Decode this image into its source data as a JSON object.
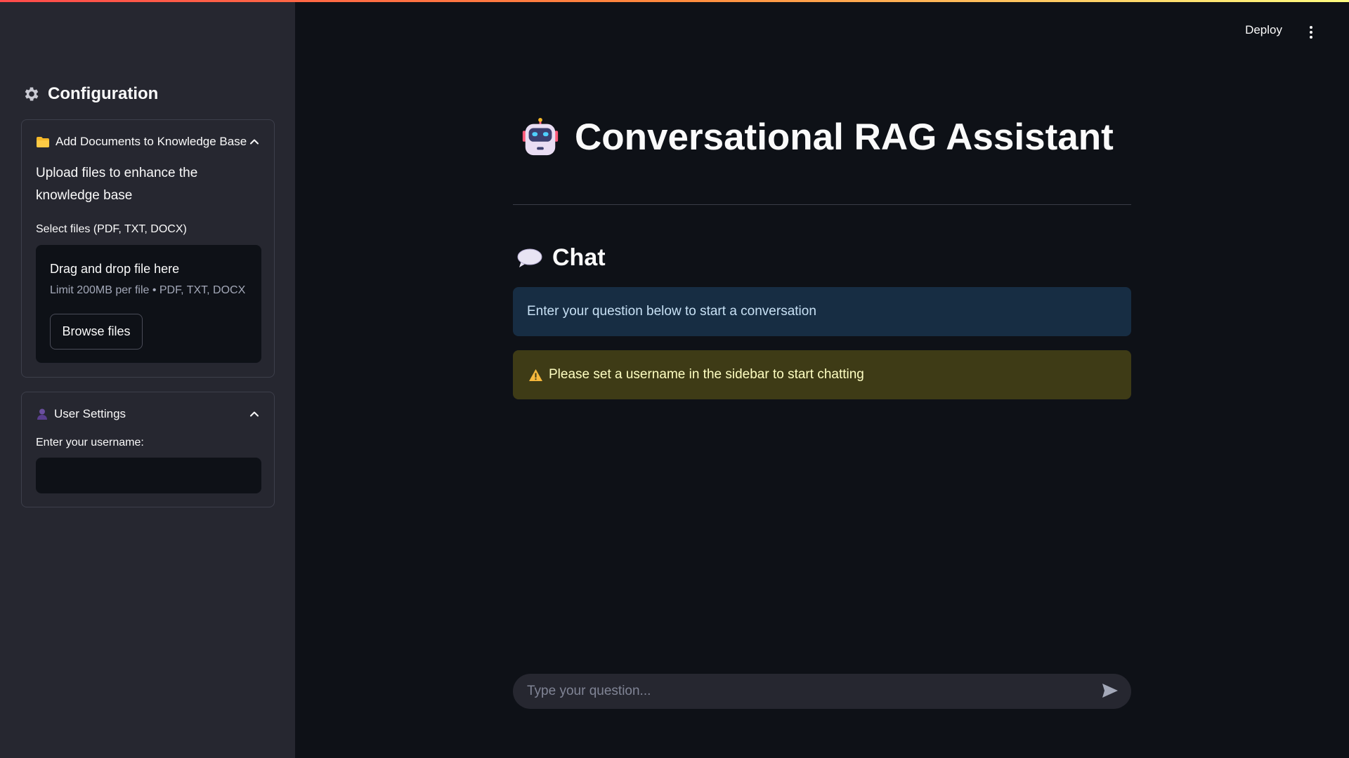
{
  "sidebar": {
    "title": "Configuration",
    "docs_expander": {
      "header": "Add Documents to Knowledge Base",
      "description": "Upload files to enhance the knowledge base",
      "select_label": "Select files (PDF, TXT, DOCX)",
      "dropzone_title": "Drag and drop file here",
      "dropzone_limit": "Limit 200MB per file • PDF, TXT, DOCX",
      "browse_label": "Browse files"
    },
    "user_expander": {
      "header": "User Settings",
      "username_label": "Enter your username:",
      "username_value": ""
    }
  },
  "header": {
    "deploy_label": "Deploy"
  },
  "main": {
    "title": "Conversational RAG Assistant",
    "chat_heading": "Chat",
    "info_message": "Enter your question below to start a conversation",
    "warning_message": "Please set a username in the sidebar to start chatting",
    "chat_placeholder": "Type your question..."
  },
  "colors": {
    "background": "#0e1117",
    "sidebar": "#262730",
    "info_bg": "#172d43",
    "warning_bg": "#3e3b16",
    "accent": "#ff4b4b"
  },
  "icons": [
    "gear-icon",
    "folder-icon",
    "chevron-up-icon",
    "user-icon",
    "robot-icon",
    "speech-bubble-icon",
    "warning-icon",
    "send-icon",
    "kebab-menu-icon"
  ]
}
